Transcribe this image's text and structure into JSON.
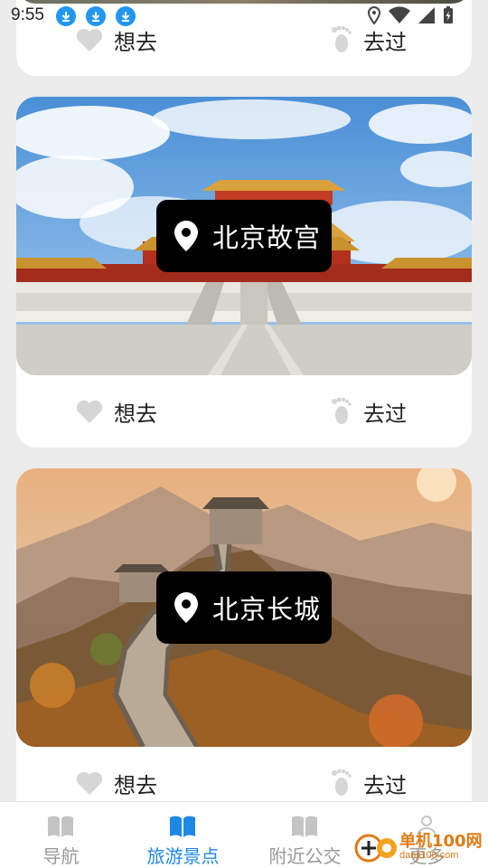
{
  "status_bar": {
    "time": "9:55"
  },
  "cards": [
    {
      "place": "",
      "want_label": "想去",
      "been_label": "去过"
    },
    {
      "place": "北京故宫",
      "want_label": "想去",
      "been_label": "去过"
    },
    {
      "place": "北京长城",
      "want_label": "想去",
      "been_label": "去过"
    }
  ],
  "bottom_nav": {
    "items": [
      {
        "label": "导航",
        "icon": "book-icon",
        "active": false
      },
      {
        "label": "旅游景点",
        "icon": "book-icon",
        "active": true
      },
      {
        "label": "附近公交",
        "icon": "book-icon",
        "active": false
      },
      {
        "label": "更多",
        "icon": "person-icon",
        "active": false
      }
    ]
  },
  "watermark": {
    "text": "单机100网",
    "url": "danji100.com"
  },
  "colors": {
    "active": "#1e88e5",
    "inactive": "#999999",
    "badge_bg": "#000000",
    "download_icon": "#2196f3"
  }
}
